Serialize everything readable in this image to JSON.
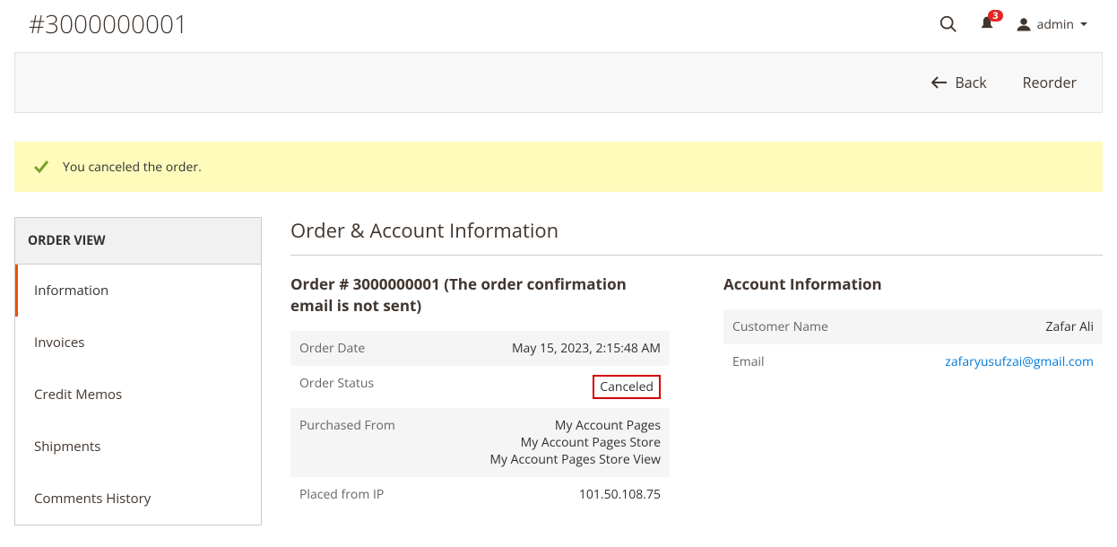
{
  "header": {
    "title": "#3000000001",
    "notification_count": "3",
    "admin_user": "admin"
  },
  "actions": {
    "back": "Back",
    "reorder": "Reorder"
  },
  "message": "You canceled the order.",
  "sidebar": {
    "heading": "ORDER VIEW",
    "items": [
      {
        "label": "Information",
        "active": true
      },
      {
        "label": "Invoices",
        "active": false
      },
      {
        "label": "Credit Memos",
        "active": false
      },
      {
        "label": "Shipments",
        "active": false
      },
      {
        "label": "Comments History",
        "active": false
      }
    ]
  },
  "section_title": "Order & Account Information",
  "order": {
    "title": "Order # 3000000001 (The order confirmation email is not sent)",
    "rows": {
      "date_label": "Order Date",
      "date_value": "May 15, 2023, 2:15:48 AM",
      "status_label": "Order Status",
      "status_value": "Canceled",
      "purchased_label": "Purchased From",
      "purchased_line1": "My Account Pages",
      "purchased_line2": "My Account Pages Store",
      "purchased_line3": "My Account Pages Store View",
      "ip_label": "Placed from IP",
      "ip_value": "101.50.108.75"
    }
  },
  "account": {
    "title": "Account Information",
    "name_label": "Customer Name",
    "name_value": "Zafar Ali",
    "email_label": "Email",
    "email_value": "zafaryusufzai@gmail.com"
  }
}
